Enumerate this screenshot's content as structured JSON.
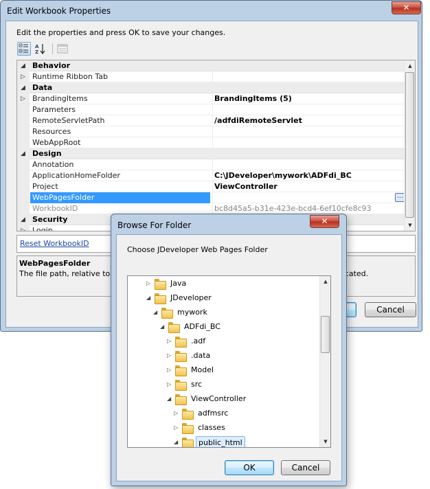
{
  "main_window": {
    "title": "Edit Workbook Properties",
    "close_label": "✕",
    "instructions": "Edit the properties and press OK to save your changes.",
    "properties": [
      {
        "type": "category",
        "name": "Behavior"
      },
      {
        "type": "prop",
        "name": "Runtime Ribbon Tab",
        "value": "",
        "expandable": true
      },
      {
        "type": "category",
        "name": "Data"
      },
      {
        "type": "prop",
        "name": "BrandingItems",
        "value": "BrandingItems (5)",
        "expandable": true
      },
      {
        "type": "prop",
        "name": "Parameters",
        "value": ""
      },
      {
        "type": "prop",
        "name": "RemoteServletPath",
        "value": "/adfdiRemoteServlet"
      },
      {
        "type": "prop",
        "name": "Resources",
        "value": ""
      },
      {
        "type": "prop",
        "name": "WebAppRoot",
        "value": ""
      },
      {
        "type": "category",
        "name": "Design"
      },
      {
        "type": "prop",
        "name": "Annotation",
        "value": ""
      },
      {
        "type": "prop",
        "name": "ApplicationHomeFolder",
        "value": "C:\\JDeveloper\\mywork\\ADFdi_BC"
      },
      {
        "type": "prop",
        "name": "Project",
        "value": "ViewController"
      },
      {
        "type": "prop",
        "name": "WebPagesFolder",
        "value": "",
        "selected": true
      },
      {
        "type": "prop",
        "name": "WorkbookID",
        "value": "bc8d45a5-b31e-423e-bcd4-6ef10cfe8c93",
        "readonly": true
      },
      {
        "type": "category",
        "name": "Security"
      },
      {
        "type": "prop",
        "name": "Login",
        "value": "",
        "expandable": true
      }
    ],
    "ellipsis_label": "...",
    "reset_link": "Reset WorkbookID",
    "description": {
      "title": "WebPagesFolder",
      "text_start": "The file path, relative to Ap",
      "text_end": "located."
    },
    "cancel_label": "Cancel"
  },
  "browse_dialog": {
    "title": "Browse For Folder",
    "close_label": "✕",
    "instructions": "Choose JDeveloper Web Pages Folder",
    "tree": [
      {
        "label": "Java",
        "level": 1,
        "state": "collapsed"
      },
      {
        "label": "JDeveloper",
        "level": 1,
        "state": "expanded"
      },
      {
        "label": "mywork",
        "level": 2,
        "state": "expanded"
      },
      {
        "label": "ADFdi_BC",
        "level": 3,
        "state": "expanded"
      },
      {
        "label": ".adf",
        "level": 4,
        "state": "collapsed"
      },
      {
        "label": ".data",
        "level": 4,
        "state": "collapsed"
      },
      {
        "label": "Model",
        "level": 4,
        "state": "collapsed"
      },
      {
        "label": "src",
        "level": 4,
        "state": "collapsed"
      },
      {
        "label": "ViewController",
        "level": 4,
        "state": "expanded"
      },
      {
        "label": "adfmsrc",
        "level": 5,
        "state": "collapsed"
      },
      {
        "label": "classes",
        "level": 5,
        "state": "collapsed"
      },
      {
        "label": "public_html",
        "level": 5,
        "state": "expanded",
        "selected": true
      }
    ],
    "ok_label": "OK",
    "cancel_label": "Cancel"
  },
  "colors": {
    "selection": "#3399ff",
    "window_frame": "#bcd0e6",
    "link": "#1b45a0"
  }
}
